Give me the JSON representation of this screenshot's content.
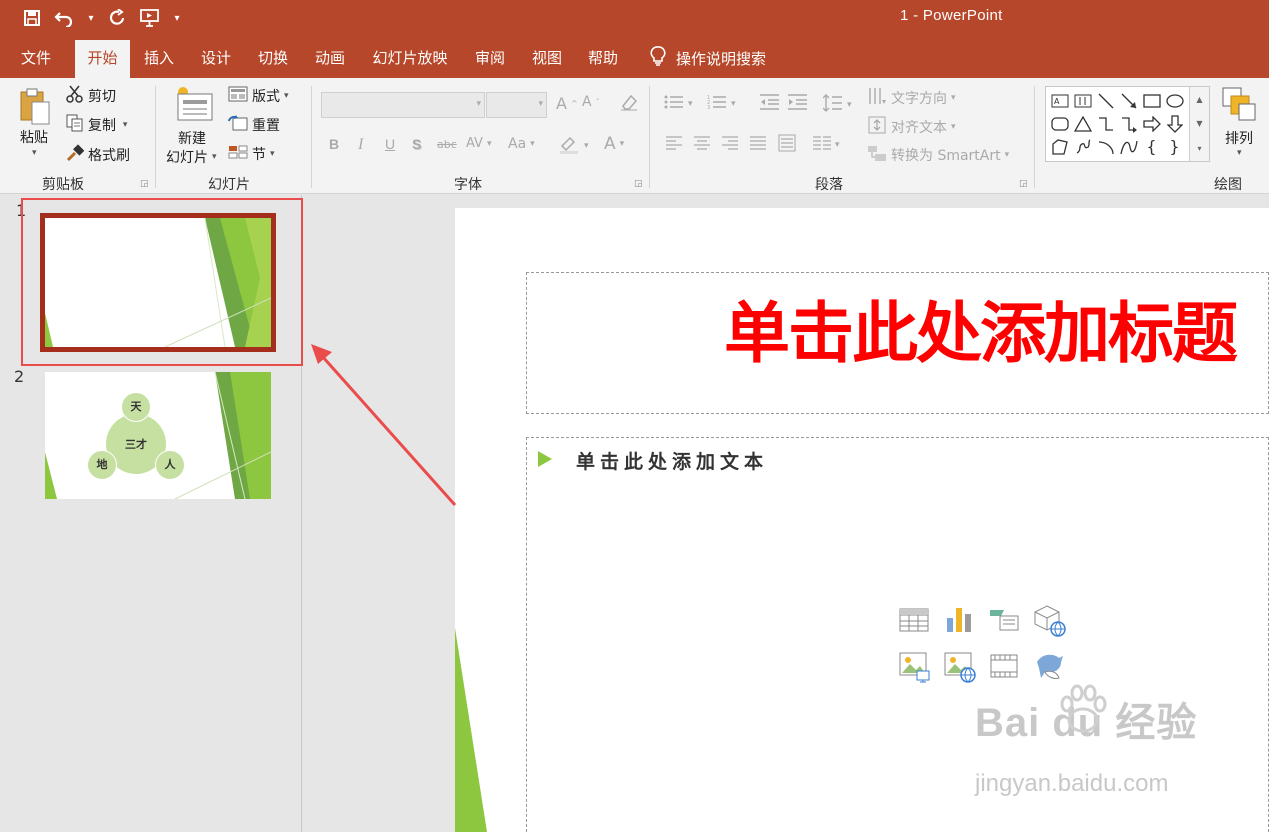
{
  "app": {
    "title": "1  -  PowerPoint",
    "qat": {
      "save_icon": "save-icon",
      "undo_icon": "undo-icon",
      "redo_icon": "redo-icon",
      "present_icon": "present-from-start-icon"
    }
  },
  "menu": {
    "tabs": [
      {
        "label": "文件"
      },
      {
        "label": "开始",
        "active": true
      },
      {
        "label": "插入"
      },
      {
        "label": "设计"
      },
      {
        "label": "切换"
      },
      {
        "label": "动画"
      },
      {
        "label": "幻灯片放映"
      },
      {
        "label": "审阅"
      },
      {
        "label": "视图"
      },
      {
        "label": "帮助"
      }
    ],
    "tell_me": "操作说明搜索"
  },
  "ribbon": {
    "clipboard": {
      "paste": "粘贴",
      "cut": "剪切",
      "copy": "复制",
      "format_painter": "格式刷",
      "label": "剪贴板"
    },
    "slides": {
      "new_slide_line1": "新建",
      "new_slide_line2": "幻灯片",
      "layout": "版式",
      "reset": "重置",
      "section": "节",
      "label": "幻灯片"
    },
    "font": {
      "label": "字体",
      "bold": "B",
      "italic": "I",
      "underline": "U",
      "shadow": "S",
      "strike": "abc",
      "spacing": "AV",
      "case": "Aa",
      "grow": "A",
      "shrink": "A",
      "color": "A"
    },
    "paragraph": {
      "label": "段落",
      "text_direction": "文字方向",
      "align_text": "对齐文本",
      "smartart": "转换为 SmartArt"
    },
    "drawing": {
      "arrange": "排列",
      "label": "绘图"
    }
  },
  "slides": [
    {
      "number": "1",
      "selected": true
    },
    {
      "number": "2",
      "center": "三才",
      "nodes": [
        "天",
        "地",
        "人"
      ]
    }
  ],
  "slide": {
    "title_placeholder": "单击此处添加标题",
    "body_placeholder": "单击此处添加文本",
    "insert_icons": [
      "table-icon",
      "chart-icon",
      "smartart-icon",
      "3d-model-icon",
      "picture-icon",
      "online-picture-icon",
      "video-icon",
      "icons-icon"
    ]
  },
  "watermark": {
    "brand": "Bai du 经验",
    "url": "jingyan.baidu.com"
  },
  "colors": {
    "accent": "#b7472a",
    "title_red": "#ff0000",
    "green": "#8dc63f",
    "selection": "#a52d1c"
  }
}
